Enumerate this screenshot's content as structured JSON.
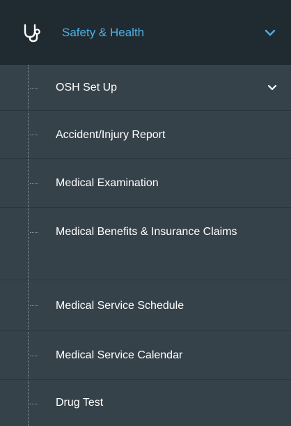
{
  "menu": {
    "header": {
      "icon": "stethoscope-icon",
      "label": "Safety & Health",
      "chevron_icon": "chevron-down-icon",
      "accent_color": "#4fb0e6"
    },
    "items": [
      {
        "label": "OSH Set Up",
        "has_chevron": true
      },
      {
        "label": "Accident/Injury Report"
      },
      {
        "label": "Medical Examination"
      },
      {
        "label": "Medical Benefits & Insurance Claims"
      },
      {
        "label": "Medical Service Schedule"
      },
      {
        "label": "Medical Service Calendar"
      },
      {
        "label": "Drug Test"
      }
    ]
  }
}
